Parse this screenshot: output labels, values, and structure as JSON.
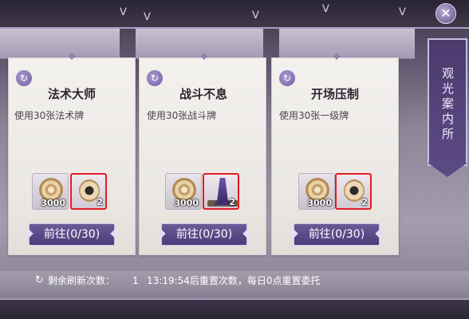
{
  "banner": {
    "title": "观光案内所"
  },
  "close_symbol": "✕",
  "cards": [
    {
      "title": "法术大师",
      "description": "使用30张法术牌",
      "cost": "3000",
      "reward_count": "2",
      "button_label": "前往(0/30)"
    },
    {
      "title": "战斗不息",
      "description": "使用30张战斗牌",
      "cost": "3000",
      "reward_count": "2",
      "button_label": "前往(0/30)"
    },
    {
      "title": "开场压制",
      "description": "使用30张一级牌",
      "cost": "3000",
      "reward_count": "2",
      "button_label": "前往(0/30)"
    }
  ],
  "footer": {
    "refresh_label": "剩余刷新次数：",
    "refresh_count": "1",
    "reset_info": "13:19:54后重置次数，每日0点重置委托"
  },
  "colors": {
    "accent": "#5b4984",
    "reward_border": "#e31c23"
  }
}
